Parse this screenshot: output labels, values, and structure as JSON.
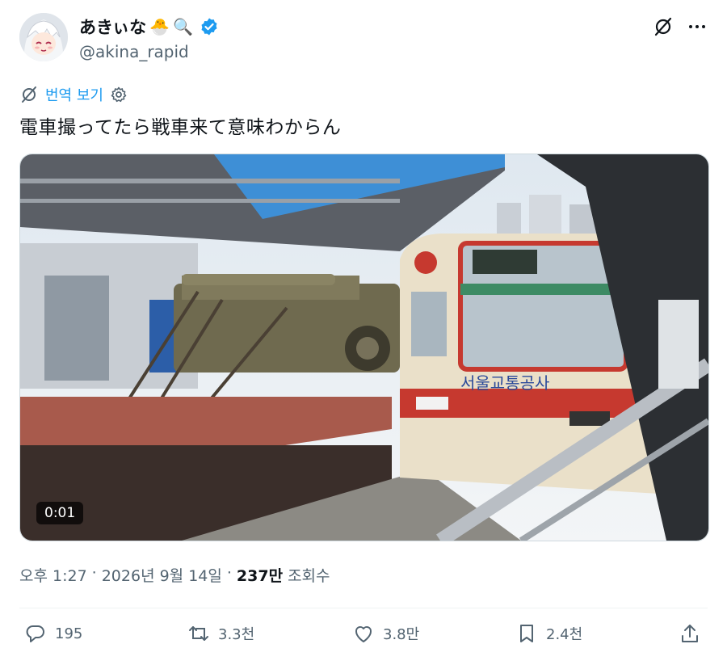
{
  "author": {
    "display_name": "あきぃな",
    "handle": "@akina_rapid",
    "name_emojis": [
      "🐣",
      "🔍"
    ]
  },
  "translate": {
    "label": "번역 보기"
  },
  "tweet": {
    "text": "電車撮ってたら戦車来て意味わからん"
  },
  "media": {
    "duration": "0:01",
    "train_sign_text": "서울교통공사"
  },
  "meta": {
    "time": "오후 1:27",
    "separator": "·",
    "date": "2026년 9월 14일",
    "views_count": "237만",
    "views_label": "조회수"
  },
  "actions": {
    "replies": "195",
    "retweets": "3.3천",
    "likes": "3.8만",
    "bookmarks": "2.4천"
  },
  "colors": {
    "accent": "#1d9bf0",
    "muted": "#536471",
    "text": "#0f1419"
  }
}
